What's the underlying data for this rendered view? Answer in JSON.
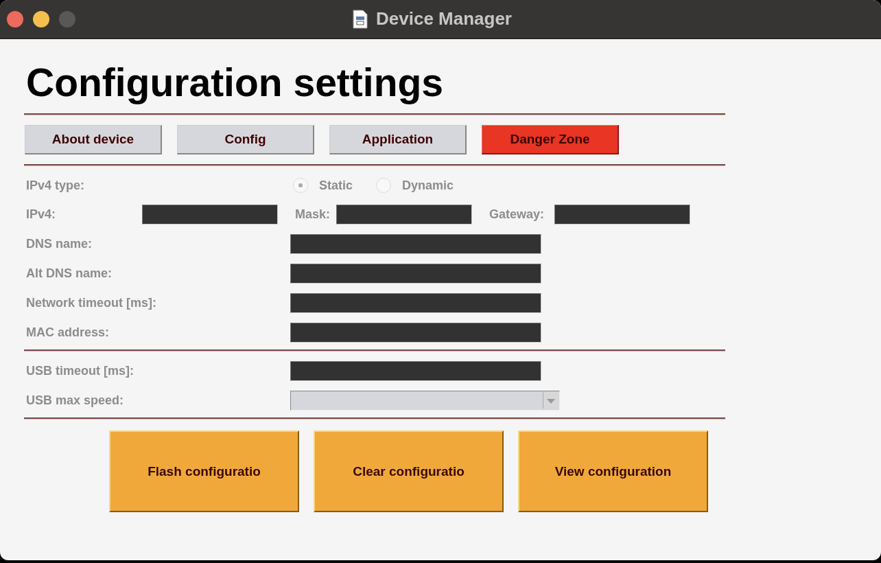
{
  "window": {
    "title": "Device Manager"
  },
  "heading": "Configuration settings",
  "tabs": [
    {
      "label": "About device",
      "kind": "normal"
    },
    {
      "label": "Config",
      "kind": "normal"
    },
    {
      "label": "Application",
      "kind": "normal"
    },
    {
      "label": "Danger Zone",
      "kind": "danger"
    }
  ],
  "network": {
    "disabled": true,
    "ipv4_type": {
      "label": "IPv4 type:",
      "options": [
        {
          "label": "Static",
          "selected": true
        },
        {
          "label": "Dynamic",
          "selected": false
        }
      ]
    },
    "address_fields": [
      {
        "label": "IPv4:"
      },
      {
        "label": "Mask:"
      },
      {
        "label": "Gateway:"
      }
    ],
    "rows": [
      {
        "label": "DNS name:",
        "kind": "text"
      },
      {
        "label": "Alt DNS name:",
        "kind": "text"
      },
      {
        "label": "Network timeout [ms]:",
        "kind": "text"
      },
      {
        "label": "MAC address:",
        "kind": "text"
      }
    ]
  },
  "usb": {
    "disabled": true,
    "rows": [
      {
        "label": "USB timeout [ms]:",
        "kind": "text"
      },
      {
        "label": "USB max speed:",
        "kind": "select"
      }
    ]
  },
  "actions": [
    "Flash configuratio",
    "Clear configuratio",
    "View configuration"
  ]
}
